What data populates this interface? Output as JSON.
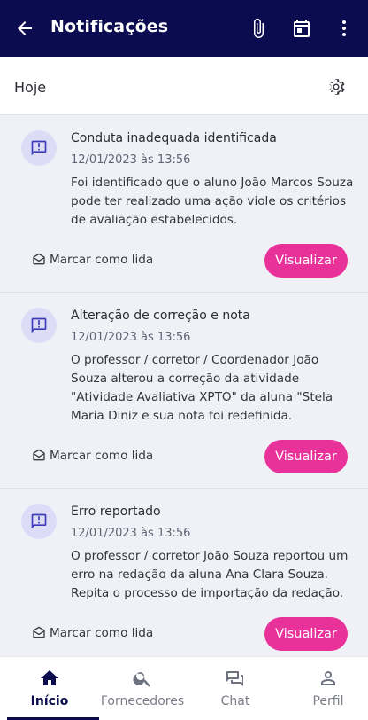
{
  "appbar": {
    "title": "Notificações",
    "icons": [
      "arrow-back-icon",
      "paperclip-icon",
      "calendar-icon",
      "more-vertical-icon"
    ],
    "background": "#0b0b4f"
  },
  "subheader": {
    "label": "Hoje",
    "icon": "gear-icon"
  },
  "notifications": [
    {
      "title": "Conduta inadequada identificada",
      "date": "12/01/2023 às 13:56",
      "body": "Foi identificado que o aluno João Marcos Souza pode ter realizado uma ação viole os critérios de avaliação estabelecidos.",
      "mark_label": "Marcar como lida",
      "action_label": "Visualizar"
    },
    {
      "title": "Alteração de correção e nota",
      "date": "12/01/2023 às 13:56",
      "body": "O professor / corretor / Coordenador  João Souza alterou a correção da atividade \"Atividade Avaliativa XPTO\" da aluna \"Stela Maria Diniz e sua nota foi redefinida.",
      "mark_label": "Marcar como lida",
      "action_label": "Visualizar"
    },
    {
      "title": "Erro reportado",
      "date": "12/01/2023 às 13:56",
      "body": "O professor / corretor João Souza reportou um erro na redação da aluna Ana Clara Souza. Repita o processo de importação da redação.",
      "mark_label": "Marcar como lida",
      "action_label": "Visualizar"
    }
  ],
  "colors": {
    "accent": "#e8329a",
    "navy": "#0b0b4f",
    "badge_bg": "#dcdcf7"
  },
  "bottom_nav": [
    {
      "label": "Início",
      "icon": "home-icon",
      "active": true
    },
    {
      "label": "Fornecedores",
      "icon": "search-icon",
      "active": false
    },
    {
      "label": "Chat",
      "icon": "chat-icon",
      "active": false
    },
    {
      "label": "Perfil",
      "icon": "person-icon",
      "active": false
    }
  ]
}
